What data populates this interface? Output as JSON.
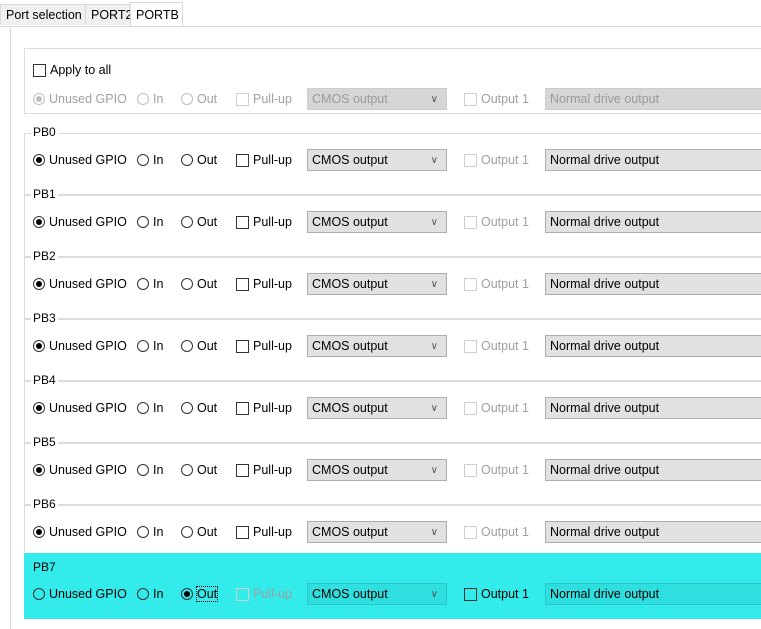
{
  "tabs": [
    {
      "label": "Port selection",
      "active": false
    },
    {
      "label": "PORT2",
      "active": false
    },
    {
      "label": "PORTB",
      "active": true
    }
  ],
  "apply_all": {
    "label": "Apply to all",
    "checked": false,
    "row": {
      "unused_label": "Unused GPIO",
      "in_label": "In",
      "out_label": "Out",
      "pullup_label": "Pull-up",
      "output_type": "CMOS output",
      "output1_label": "Output 1",
      "drive": "Normal drive output"
    }
  },
  "pins": [
    {
      "name": "PB0",
      "mode": "unused",
      "unused_label": "Unused GPIO",
      "in_label": "In",
      "out_label": "Out",
      "pullup_label": "Pull-up",
      "output_type": "CMOS output",
      "output1_label": "Output 1",
      "drive": "Normal drive output"
    },
    {
      "name": "PB1",
      "mode": "unused",
      "unused_label": "Unused GPIO",
      "in_label": "In",
      "out_label": "Out",
      "pullup_label": "Pull-up",
      "output_type": "CMOS output",
      "output1_label": "Output 1",
      "drive": "Normal drive output"
    },
    {
      "name": "PB2",
      "mode": "unused",
      "unused_label": "Unused GPIO",
      "in_label": "In",
      "out_label": "Out",
      "pullup_label": "Pull-up",
      "output_type": "CMOS output",
      "output1_label": "Output 1",
      "drive": "Normal drive output"
    },
    {
      "name": "PB3",
      "mode": "unused",
      "unused_label": "Unused GPIO",
      "in_label": "In",
      "out_label": "Out",
      "pullup_label": "Pull-up",
      "output_type": "CMOS output",
      "output1_label": "Output 1",
      "drive": "Normal drive output"
    },
    {
      "name": "PB4",
      "mode": "unused",
      "unused_label": "Unused GPIO",
      "in_label": "In",
      "out_label": "Out",
      "pullup_label": "Pull-up",
      "output_type": "CMOS output",
      "output1_label": "Output 1",
      "drive": "Normal drive output"
    },
    {
      "name": "PB5",
      "mode": "unused",
      "unused_label": "Unused GPIO",
      "in_label": "In",
      "out_label": "Out",
      "pullup_label": "Pull-up",
      "output_type": "CMOS output",
      "output1_label": "Output 1",
      "drive": "Normal drive output"
    },
    {
      "name": "PB6",
      "mode": "unused",
      "unused_label": "Unused GPIO",
      "in_label": "In",
      "out_label": "Out",
      "pullup_label": "Pull-up",
      "output_type": "CMOS output",
      "output1_label": "Output 1",
      "drive": "Normal drive output"
    },
    {
      "name": "PB7",
      "mode": "out",
      "unused_label": "Unused GPIO",
      "in_label": "In",
      "out_label": "Out",
      "pullup_label": "Pull-up",
      "output_type": "CMOS output",
      "output1_label": "Output 1",
      "drive": "Normal drive output"
    }
  ],
  "colors": {
    "highlight": "#33ebeb"
  }
}
